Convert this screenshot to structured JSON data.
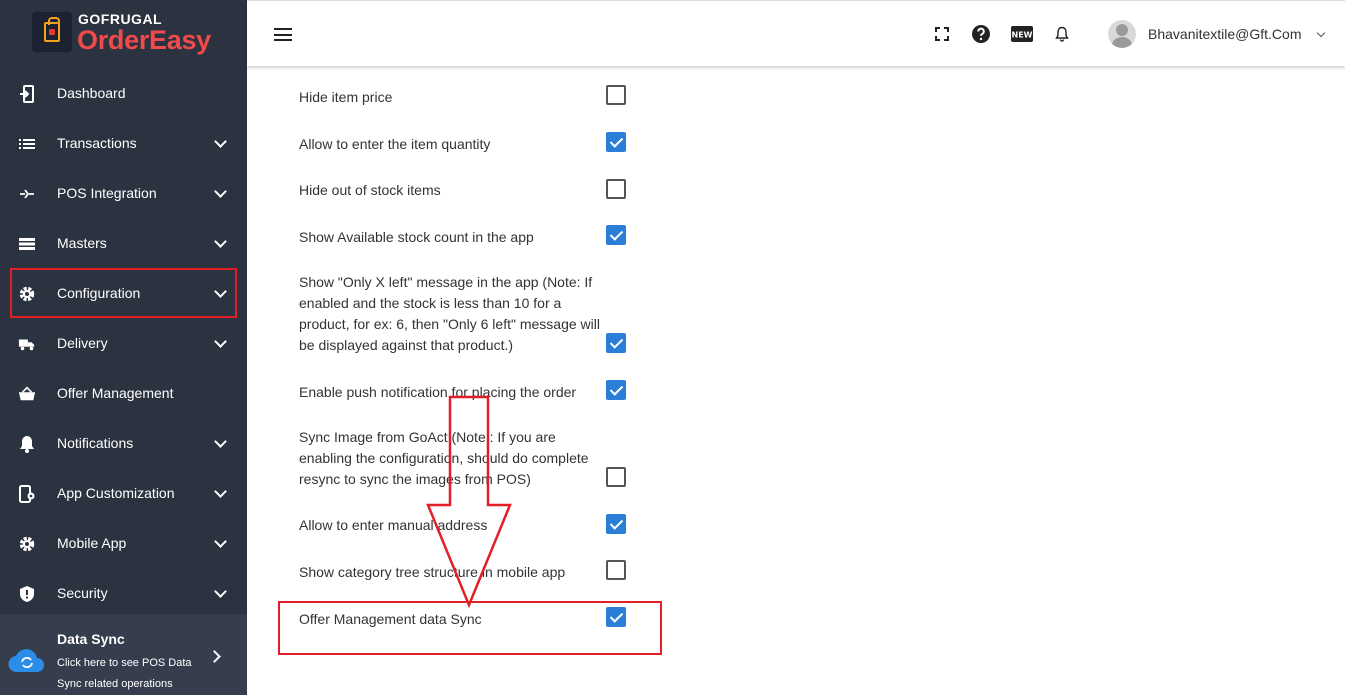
{
  "brand": {
    "top": "GOFRUGAL",
    "main": "OrderEasy"
  },
  "sidebar": {
    "items": [
      {
        "label": "Dashboard",
        "icon": "dashboard-icon",
        "has_chevron": false
      },
      {
        "label": "Transactions",
        "icon": "list-icon",
        "has_chevron": true
      },
      {
        "label": "POS Integration",
        "icon": "integration-icon",
        "has_chevron": true
      },
      {
        "label": "Masters",
        "icon": "masters-icon",
        "has_chevron": true
      },
      {
        "label": "Configuration",
        "icon": "gear-icon",
        "has_chevron": true
      },
      {
        "label": "Delivery",
        "icon": "delivery-icon",
        "has_chevron": true
      },
      {
        "label": "Offer Management",
        "icon": "basket-icon",
        "has_chevron": false
      },
      {
        "label": "Notifications",
        "icon": "bell-icon",
        "has_chevron": true
      },
      {
        "label": "App Customization",
        "icon": "app-customization-icon",
        "has_chevron": true
      },
      {
        "label": "Mobile App",
        "icon": "gear-icon",
        "has_chevron": true
      },
      {
        "label": "Security",
        "icon": "shield-icon",
        "has_chevron": true
      }
    ],
    "data_sync": {
      "title": "Data Sync",
      "subtitle": "Click here to see POS Data Sync related operations"
    }
  },
  "header": {
    "icons": [
      "fullscreen-icon",
      "help-icon",
      "new-badge-icon",
      "bell-icon"
    ],
    "new_badge": "NEW",
    "user_email": "Bhavanitextile@Gft.Com"
  },
  "settings": [
    {
      "label": "Hide item price",
      "checked": false
    },
    {
      "label": "Allow to enter the item quantity",
      "checked": true
    },
    {
      "label": "Hide out of stock items",
      "checked": false
    },
    {
      "label": "Show Available stock count in the app",
      "checked": true
    },
    {
      "label": "Show \"Only X left\" message in the app (Note: If enabled and the stock is less than 10 for a product, for ex: 6, then \"Only 6 left\" message will be displayed against that product.)",
      "checked": true
    },
    {
      "label": "Enable push notification for placing the order",
      "checked": true
    },
    {
      "label": "Sync Image from GoAct (Note : If you are enabling the configuration, should do complete resync to sync the images from POS)",
      "checked": false
    },
    {
      "label": "Allow to enter manual address",
      "checked": true
    },
    {
      "label": "Show category tree structure in mobile app",
      "checked": false
    },
    {
      "label": "Offer Management data Sync",
      "checked": true
    }
  ],
  "colors": {
    "sidebar_bg": "#2b3240",
    "accent": "#2a7ed8",
    "highlight": "#e21f26",
    "brand_red": "#f04a4a"
  }
}
